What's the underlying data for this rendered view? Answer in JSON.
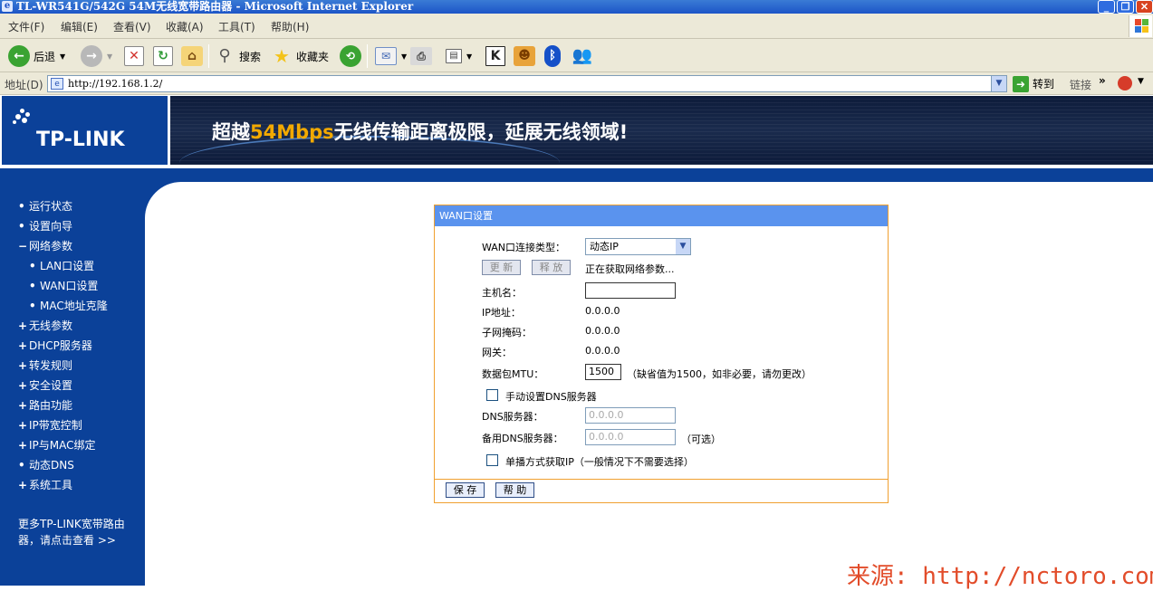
{
  "window": {
    "title": "TL-WR541G/542G 54M无线宽带路由器 - Microsoft Internet Explorer",
    "min_glyph": "_",
    "max_glyph": "❐",
    "close_glyph": "✕"
  },
  "menu": {
    "items": [
      "文件(F)",
      "编辑(E)",
      "查看(V)",
      "收藏(A)",
      "工具(T)",
      "帮助(H)"
    ]
  },
  "toolbar": {
    "back_label": "后退",
    "search_label": "搜索",
    "favorites_label": "收藏夹"
  },
  "address": {
    "label": "地址(D)",
    "url": "http://192.168.1.2/",
    "go_label": "转到",
    "links_label": "链接",
    "links_chevron": "»"
  },
  "banner": {
    "logo_text": "TP-LINK",
    "slogan_before": "超越",
    "slogan_highlight": "54Mbps",
    "slogan_after": "无线传输距离极限，延展无线领域!"
  },
  "sidebar": {
    "items": [
      {
        "bullet": "•",
        "label": "运行状态"
      },
      {
        "bullet": "•",
        "label": "设置向导"
      },
      {
        "bullet": "−",
        "label": "网络参数"
      },
      {
        "bullet": "•",
        "label": "LAN口设置"
      },
      {
        "bullet": "•",
        "label": "WAN口设置"
      },
      {
        "bullet": "•",
        "label": "MAC地址克隆"
      },
      {
        "bullet": "+",
        "label": "无线参数"
      },
      {
        "bullet": "+",
        "label": "DHCP服务器"
      },
      {
        "bullet": "+",
        "label": "转发规则"
      },
      {
        "bullet": "+",
        "label": "安全设置"
      },
      {
        "bullet": "+",
        "label": "路由功能"
      },
      {
        "bullet": "+",
        "label": "IP带宽控制"
      },
      {
        "bullet": "+",
        "label": "IP与MAC绑定"
      },
      {
        "bullet": "•",
        "label": "动态DNS"
      },
      {
        "bullet": "+",
        "label": "系统工具"
      }
    ],
    "more_text": "更多TP-LINK宽带路由器，请点击查看 >>"
  },
  "panel": {
    "title": "WAN口设置",
    "conn_type_label": "WAN口连接类型：",
    "conn_type_value": "动态IP",
    "renew_button": "更 新",
    "release_button": "释 放",
    "status_text": "正在获取网络参数...",
    "hostname_label": "主机名：",
    "hostname_value": "",
    "ip_label": "IP地址：",
    "ip_value": "0.0.0.0",
    "mask_label": "子网掩码：",
    "mask_value": "0.0.0.0",
    "gateway_label": "网关：",
    "gateway_value": "0.0.0.0",
    "mtu_label": "数据包MTU：",
    "mtu_value": "1500",
    "mtu_hint": "（缺省值为1500，如非必要，请勿更改）",
    "manual_dns_label": "手动设置DNS服务器",
    "manual_dns_checked": false,
    "dns_label": "DNS服务器：",
    "dns_value": "0.0.0.0",
    "alt_dns_label": "备用DNS服务器：",
    "alt_dns_value": "0.0.0.0",
    "alt_dns_hint": "（可选）",
    "unicast_label": "单播方式获取IP（一般情况下不需要选择）",
    "unicast_checked": false,
    "save_button": "保 存",
    "help_button": "帮 助"
  },
  "watermark": "来源: http://nctoro.com",
  "colors": {
    "sidebar_bg": "#0b4199",
    "panel_header": "#5a93ee",
    "panel_border": "#f0a030",
    "watermark": "#e24c2a"
  }
}
